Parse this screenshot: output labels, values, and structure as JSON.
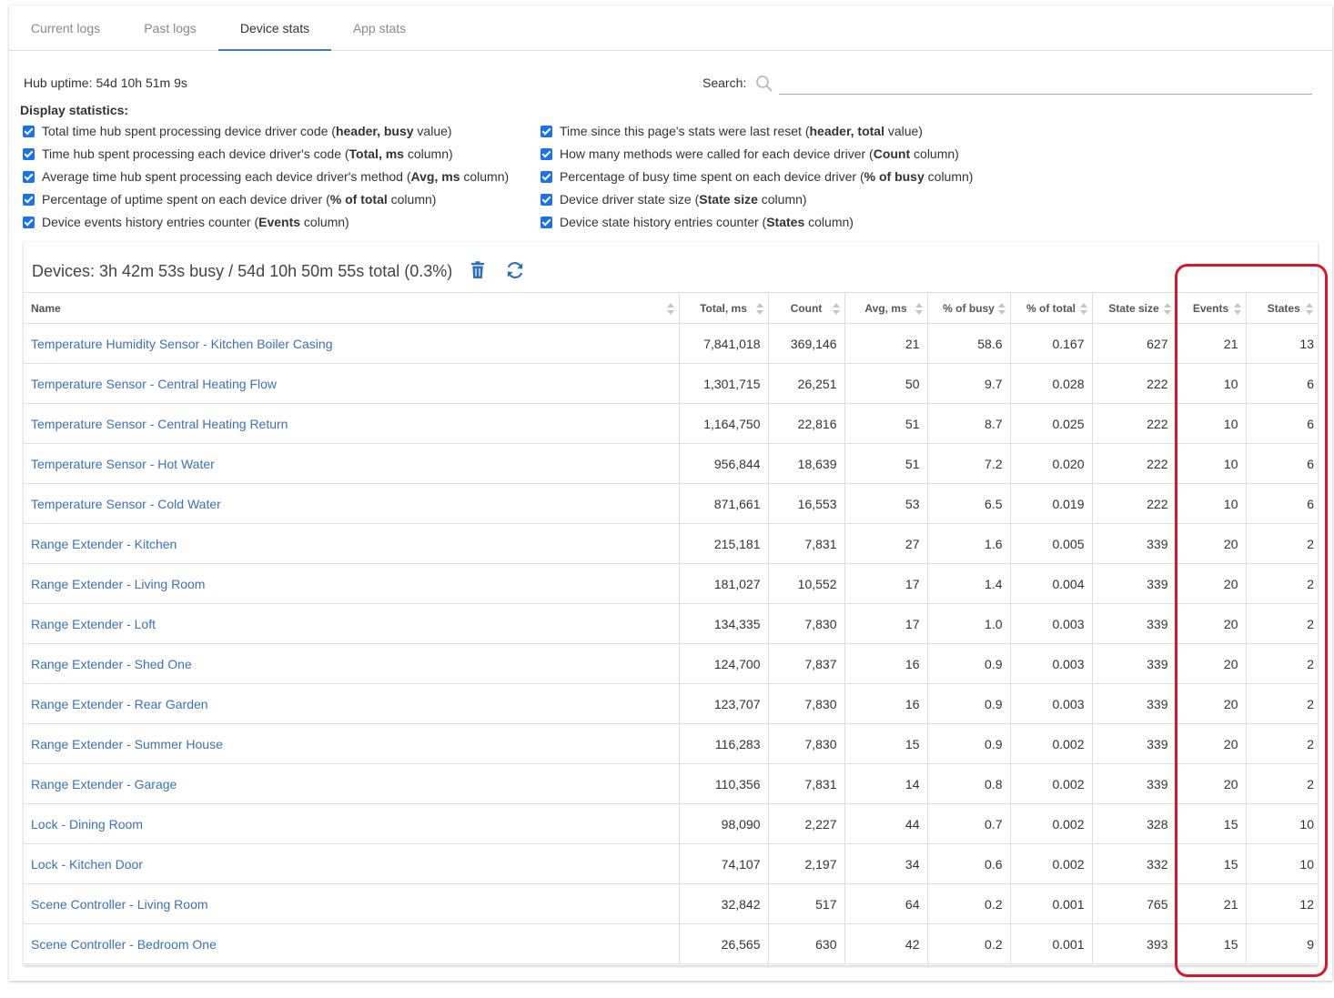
{
  "tabs": [
    {
      "label": "Current logs",
      "active": false
    },
    {
      "label": "Past logs",
      "active": false
    },
    {
      "label": "Device stats",
      "active": true
    },
    {
      "label": "App stats",
      "active": false
    }
  ],
  "uptime": {
    "label": "Hub uptime:",
    "value": "54d 10h 51m 9s"
  },
  "search": {
    "label": "Search:",
    "value": "",
    "placeholder": ""
  },
  "display_statistics": {
    "title": "Display statistics:",
    "options": [
      {
        "pre": "Total time hub spent processing device driver code (",
        "bold": "header, busy",
        "post": " value)",
        "checked": true
      },
      {
        "pre": "Time hub spent processing each device driver's code (",
        "bold": "Total, ms",
        "post": " column)",
        "checked": true
      },
      {
        "pre": "Average time hub spent processing each device driver's method (",
        "bold": "Avg, ms",
        "post": " column)",
        "checked": true
      },
      {
        "pre": "Percentage of uptime spent on each device driver (",
        "bold": "% of total",
        "post": " column)",
        "checked": true
      },
      {
        "pre": "Device events history entries counter (",
        "bold": "Events",
        "post": " column)",
        "checked": true
      },
      {
        "pre": "Time since this page's stats were last reset (",
        "bold": "header, total",
        "post": " value)",
        "checked": true
      },
      {
        "pre": "How many methods were called for each device driver (",
        "bold": "Count",
        "post": " column)",
        "checked": true
      },
      {
        "pre": "Percentage of busy time spent on each device driver (",
        "bold": "% of busy",
        "post": " column)",
        "checked": true
      },
      {
        "pre": "Device driver state size (",
        "bold": "State size",
        "post": " column)",
        "checked": true
      },
      {
        "pre": "Device state history entries counter (",
        "bold": "States",
        "post": " column)",
        "checked": true
      }
    ]
  },
  "devices_card": {
    "title": "Devices: 3h 42m 53s busy / 54d 10h 50m 55s total (0.3%)",
    "icons": {
      "delete": "trash-icon",
      "refresh": "refresh-icon"
    },
    "columns": [
      "Name",
      "Total, ms",
      "Count",
      "Avg, ms",
      "% of busy",
      "% of total",
      "State size",
      "Events",
      "States"
    ],
    "rows": [
      [
        "Temperature Humidity Sensor - Kitchen Boiler Casing",
        "7,841,018",
        "369,146",
        "21",
        "58.6",
        "0.167",
        "627",
        "21",
        "13"
      ],
      [
        "Temperature Sensor - Central Heating Flow",
        "1,301,715",
        "26,251",
        "50",
        "9.7",
        "0.028",
        "222",
        "10",
        "6"
      ],
      [
        "Temperature Sensor - Central Heating Return",
        "1,164,750",
        "22,816",
        "51",
        "8.7",
        "0.025",
        "222",
        "10",
        "6"
      ],
      [
        "Temperature Sensor - Hot Water",
        "956,844",
        "18,639",
        "51",
        "7.2",
        "0.020",
        "222",
        "10",
        "6"
      ],
      [
        "Temperature Sensor - Cold Water",
        "871,661",
        "16,553",
        "53",
        "6.5",
        "0.019",
        "222",
        "10",
        "6"
      ],
      [
        "Range Extender - Kitchen",
        "215,181",
        "7,831",
        "27",
        "1.6",
        "0.005",
        "339",
        "20",
        "2"
      ],
      [
        "Range Extender - Living Room",
        "181,027",
        "10,552",
        "17",
        "1.4",
        "0.004",
        "339",
        "20",
        "2"
      ],
      [
        "Range Extender - Loft",
        "134,335",
        "7,830",
        "17",
        "1.0",
        "0.003",
        "339",
        "20",
        "2"
      ],
      [
        "Range Extender - Shed One",
        "124,700",
        "7,837",
        "16",
        "0.9",
        "0.003",
        "339",
        "20",
        "2"
      ],
      [
        "Range Extender - Rear Garden",
        "123,707",
        "7,830",
        "16",
        "0.9",
        "0.003",
        "339",
        "20",
        "2"
      ],
      [
        "Range Extender - Summer House",
        "116,283",
        "7,830",
        "15",
        "0.9",
        "0.002",
        "339",
        "20",
        "2"
      ],
      [
        "Range Extender - Garage",
        "110,356",
        "7,831",
        "14",
        "0.8",
        "0.002",
        "339",
        "20",
        "2"
      ],
      [
        "Lock - Dining Room",
        "98,090",
        "2,227",
        "44",
        "0.7",
        "0.002",
        "328",
        "15",
        "10"
      ],
      [
        "Lock - Kitchen Door",
        "74,107",
        "2,197",
        "34",
        "0.6",
        "0.002",
        "332",
        "15",
        "10"
      ],
      [
        "Scene Controller - Living Room",
        "32,842",
        "517",
        "64",
        "0.2",
        "0.001",
        "765",
        "21",
        "12"
      ],
      [
        "Scene Controller - Bedroom One",
        "26,565",
        "630",
        "42",
        "0.2",
        "0.001",
        "393",
        "15",
        "9"
      ]
    ]
  },
  "colors": {
    "accent": "#1a73e8",
    "link": "#3b72b5",
    "highlight": "#d9162a"
  }
}
